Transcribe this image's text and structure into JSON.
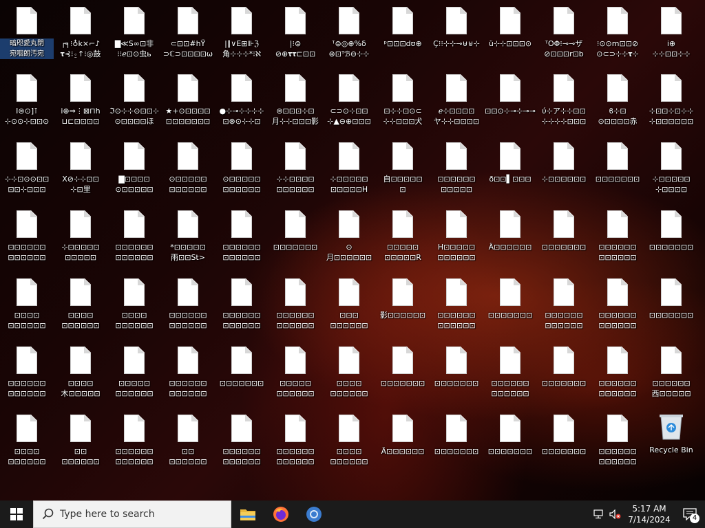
{
  "desktop": {
    "rows": [
      [
        "暗咫愛丸閉\n宛咽朗汚宛",
        "┌╕⁝♁k⨯⌐♪\n𝛕⊰⁝⍛↑⁝◎鼓",
        "▇≪S∞⊡非\n⁝⁝ℯ⊡⊙虫ь",
        "⊂⊡⊡#hΫ\n⊃ℂ⊃⊡⊡⊡⊡ω",
        "|∥∨Ε⊞⊪ℨ\n角⊹⊹⊹*⁝ℵ",
        "|⁝⊜\n⊘⊕𝛕𝛕⊏⊡⊡",
        "ᵀ⊜◎⊕%δ\n⊛⊡ᵀℬ⊖⊹⊹",
        "ᵖ⊡⊡⊡dʊ⊕",
        "Ç⁝⁝⊹⊹⊸⊎⊎⊹",
        "ü⊹⊹⊡⊡⊡⊙",
        "ᵀOΦ⁝⊸⊸ザ\n⊘⊡⊡⊡r⊡b",
        "⁝⊙⊙m⊡⊡⊘\n⊙⊂⊃⊹⊹𝛕⊹",
        "i⊕\n⊹⊹⊡⊡⊹⊹"
      ],
      [
        "Ι⊜⊙]⊺\n⊹⊙⊙⊹⊡⊡⊙",
        "i⊕⇒⋮⊠⊓h\n⊔⊏⊡⊡⊡⊡",
        "ℑ⊙⊹⊹⊙⊡⊡⊹\n⊙⊡⊡⊡⊡ほ",
        "★+⊙⊡⊡⊡⊡\n⊡⊡⊡⊡⊡⊡⊡",
        "●⊹⊸⊹⊹⊹⊹\n⊡⊗⊙⊹⊹⊡",
        "⊜⊡⊡⊡⊹⊡\n月⊹⊹⊡⊡⊡影",
        "⊂⊃⊙⊹⊡⊡\n⊹▲⊖⊕⊡⊡⊡",
        "⊡⊹⊹⊡⊙⊂\n⊹⊹⊡⊡⊡犬",
        "ℯ⊹⊡⊡⊡⊡\nヤ⊹⊹⊡⊡⊡⊡",
        "⊡⊡⊙⊹⊸⊹⊸⊸",
        "ύ⊹ア⊹⊹⊡⊡\n⊹⊹⊹⊹⊡⊡⊡",
        "ϐ⊹⊡\n⊙⊡⊡⊡⊡赤",
        "⊹⊡⊡⊹⊡⊹⊹\n⊹⊡⊡⊡⊡⊡⊡"
      ],
      [
        "⊹⊹⊡⊙⊙⊡⊡\n⊡⊡⊹⊡⊡⊡",
        "X⊘⊹⊹⊡⊡\n⊹⊡里",
        "▇⊡⊡⊡⊡\n⊙⊡⊡⊡⊡⊡",
        "⊙⊡⊡⊡⊡⊡\n⊡⊡⊡⊡⊡⊡",
        "⊙⊡⊡⊡⊡⊡\n⊡⊡⊡⊡⊡⊡",
        "⊹⊹⊡⊡⊡⊡\n⊡⊡⊡⊡⊡⊡",
        "⊹⊡⊡⊡⊡⊡\n⊡⊡⊡⊡⊡H",
        "自⊡⊡⊡⊡⊡\n⊡",
        "⊡⊡⊡⊡⊡⊡\n⊡⊡⊡⊡⊡",
        "ð⊡⊡▌⊡⊡⊡",
        "⊹⊡⊡⊡⊡⊡⊡",
        "⊡⊡⊡⊡⊡⊡⊡",
        "⊹⊡⊡⊡⊡⊡\n⊹⊡⊡⊡⊡"
      ],
      [
        "⊡⊡⊡⊡⊡⊡\n⊡⊡⊡⊡⊡⊡",
        "⊹⊡⊡⊡⊡⊡\n⊡⊡⊡⊡⊡",
        "⊡⊡⊡⊡⊡⊡\n⊡⊡⊡⊡⊡⊡",
        "*⊡⊡⊡⊡⊡\n雨⊡⊡St>",
        "⊡⊡⊡⊡⊡⊡\n⊡⊡⊡⊡⊡⊡",
        "⊡⊡⊡⊡⊡⊡⊡",
        "⊙\n月⊡⊡⊡⊡⊡⊡",
        "⊡⊡⊡⊡⊡\n⊡⊡⊡⊡⊡R",
        "H⊡⊡⊡⊡⊡\n⊡⊡⊡⊡⊡⊡",
        "Ä⊡⊡⊡⊡⊡⊡",
        "⊡⊡⊡⊡⊡⊡⊡",
        "⊡⊡⊡⊡⊡⊡\n⊡⊡⊡⊡⊡⊡",
        "⊡⊡⊡⊡⊡⊡⊡"
      ],
      [
        "⊡⊡⊡⊡\n⊡⊡⊡⊡⊡⊡",
        "⊡⊡⊡⊡\n⊡⊡⊡⊡⊡⊡",
        "⊡⊡⊡⊡\n⊡⊡⊡⊡⊡⊡",
        "⊡⊡⊡⊡⊡⊡\n⊡⊡⊡⊡⊡⊡",
        "⊡⊡⊡⊡⊡⊡\n⊡⊡⊡⊡⊡⊡",
        "⊡⊡⊡⊡⊡⊡\n⊡⊡⊡⊡⊡⊡",
        "⊡⊡⊡\n⊡⊡⊡⊡⊡⊡",
        "影⊡⊡⊡⊡⊡⊡",
        "⊡⊡⊡⊡⊡⊡\n⊡⊡⊡⊡⊡⊡",
        "⊡⊡⊡⊡⊡⊡⊡",
        "⊡⊡⊡⊡⊡⊡\n⊡⊡⊡⊡⊡⊡",
        "⊡⊡⊡⊡⊡⊡\n⊡⊡⊡⊡⊡⊡",
        "⊡⊡⊡⊡⊡⊡⊡"
      ],
      [
        "⊡⊡⊡⊡⊡⊡\n⊡⊡⊡⊡⊡⊡",
        "⊡⊡⊡⊡\n木⊡⊡⊡⊡⊡",
        "⊡⊡⊡⊡⊡\n⊡⊡⊡⊡⊡⊡",
        "⊡⊡⊡⊡⊡⊡\n⊡⊡⊡⊡⊡⊡",
        "⊡⊡⊡⊡⊡⊡⊡",
        "⊡⊡⊡⊡⊡\n⊡⊡⊡⊡⊡⊡",
        "⊡⊡⊡⊡\n⊡⊡⊡⊡⊡⊡",
        "⊡⊡⊡⊡⊡⊡⊡",
        "⊡⊡⊡⊡⊡⊡⊡",
        "⊡⊡⊡⊡⊡⊡\n⊡⊡⊡⊡⊡⊡",
        "⊡⊡⊡⊡⊡⊡⊡",
        "⊡⊡⊡⊡⊡⊡\n⊡⊡⊡⊡⊡⊡",
        "⊡⊡⊡⊡⊡⊡\n西⊡⊡⊡⊡⊡"
      ],
      [
        "⊡⊡⊡⊡\n⊡⊡⊡⊡⊡⊡",
        "⊡⊡\n⊡⊡⊡⊡⊡⊡",
        "⊡⊡⊡⊡⊡⊡\n⊡⊡⊡⊡⊡⊡",
        "⊡⊡\n⊡⊡⊡⊡⊡⊡",
        "⊡⊡⊡⊡⊡⊡\n⊡⊡⊡⊡⊡⊡",
        "⊡⊡⊡⊡⊡⊡\n⊡⊡⊡⊡⊡⊡",
        "⊡⊡⊡⊡\n⊡⊡⊡⊡⊡⊡",
        "Ã⊡⊡⊡⊡⊡⊡",
        "⊡⊡⊡⊡⊡⊡⊡",
        "⊡⊡⊡⊡⊡⊡⊡",
        "⊡⊡⊡⊡⊡⊡⊡",
        "⊡⊡⊡⊡⊡⊡\n⊡⊡⊡⊡⊡⊡",
        "Recycle Bin"
      ]
    ]
  },
  "taskbar": {
    "search_placeholder": "Type here to search",
    "apps": [
      "file-explorer",
      "firefox",
      "chrome"
    ],
    "time": "5:17 AM",
    "date": "7/14/2024",
    "notification_count": "4"
  }
}
